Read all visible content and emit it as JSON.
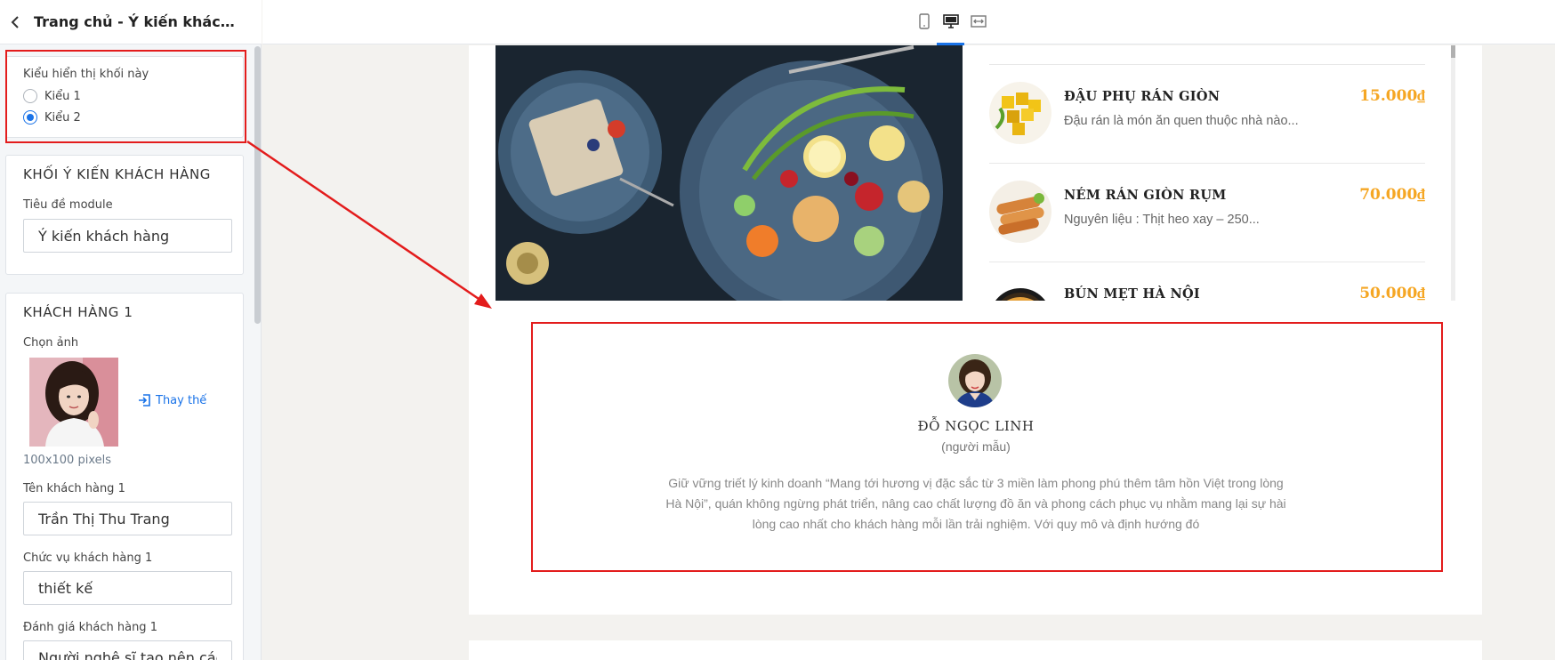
{
  "sidebar": {
    "title": "Trang chủ - Ý kiến khách hà...",
    "display_style": {
      "label": "Kiểu hiển thị khối này",
      "options": [
        {
          "label": "Kiểu 1",
          "selected": false
        },
        {
          "label": "Kiểu 2",
          "selected": true
        }
      ]
    },
    "testimonial_block": {
      "heading": "KHỐI Ý KIẾN KHÁCH HÀNG",
      "module_title_label": "Tiêu đề module",
      "module_title_value": "Ý kiến khách hàng"
    },
    "customer1": {
      "heading": "KHÁCH HÀNG 1",
      "image_label": "Chọn ảnh",
      "replace_label": "Thay thế",
      "image_size_hint": "100x100 pixels",
      "name_label": "Tên khách hàng 1",
      "name_value": "Trần Thị Thu Trang",
      "position_label": "Chức vụ khách hàng 1",
      "position_value": "thiết kế",
      "review_label": "Đánh giá khách hàng 1",
      "review_value": "Người nghệ sĩ tạo nên các"
    }
  },
  "topbar": {
    "devices": [
      {
        "icon": "mobile-icon",
        "active": false
      },
      {
        "icon": "desktop-icon",
        "active": true
      },
      {
        "icon": "fullwidth-icon",
        "active": false
      }
    ]
  },
  "menu": {
    "items": [
      {
        "name": "ĐẬU PHỤ RÁN GIÒN",
        "desc": "Đậu rán là món ăn quen thuộc nhà nào...",
        "price": "15.000₫"
      },
      {
        "name": "NÉM RÁN GIÒN RỤM",
        "desc": "Nguyên liệu : Thịt heo xay – 250...",
        "price": "70.000₫"
      },
      {
        "name": "BÚN MẸT HÀ NỘI",
        "desc": "",
        "price": "50.000₫"
      }
    ]
  },
  "testimonial": {
    "name": "ĐỖ NGỌC LINH",
    "role": "(người mẫu)",
    "quote": "Giữ vững triết lý kinh doanh “Mang tới hương vị đặc sắc từ 3 miền làm phong phú thêm tâm hồn Việt trong lòng Hà Nội”, quán không ngừng phát triển, nâng cao chất lượng đồ ăn và phong cách phục vụ nhằm mang lại sự hài lòng cao nhất cho khách hàng mỗi lần trải nghiệm. Với quy mô và định hướng đó"
  },
  "colors": {
    "accent": "#1a73e8",
    "price": "#f5a623",
    "annotation": "#e31c1c"
  }
}
